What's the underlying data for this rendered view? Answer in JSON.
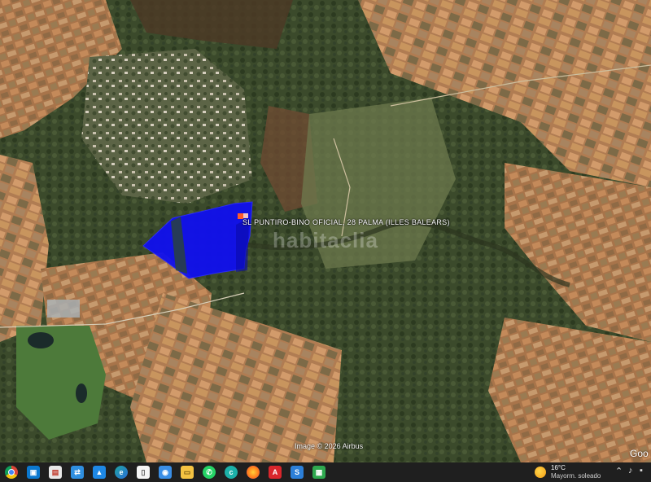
{
  "map": {
    "parcel_label": "SL PUNTIRO-BINO OFICIAL, 28 PALMA (ILLES BALEARS)",
    "watermark": "habitaclia",
    "attribution": "Image © 2026 Airbus",
    "logo": "Goo",
    "parcel_fill_color": "#1010ee",
    "marker_color": "#ff5a2a"
  },
  "taskbar": {
    "apps": [
      {
        "name": "chrome-icon",
        "color": "#db4437"
      },
      {
        "name": "remote-desktop-icon",
        "color": "#0b78d0"
      },
      {
        "name": "presentation-icon",
        "color": "#e8e8e8"
      },
      {
        "name": "network-icon",
        "color": "#2f8fe0"
      },
      {
        "name": "photos-icon",
        "color": "#1e88e5"
      },
      {
        "name": "edge-icon",
        "color": "#1ea3a3"
      },
      {
        "name": "document-icon",
        "color": "#f5f5f5"
      },
      {
        "name": "camera-icon",
        "color": "#3a8ee6"
      },
      {
        "name": "file-explorer-icon",
        "color": "#f5c342"
      },
      {
        "name": "whatsapp-icon",
        "color": "#25d366"
      },
      {
        "name": "teams-icon",
        "color": "#1cb0a8"
      },
      {
        "name": "firefox-icon",
        "color": "#ff7a1a"
      },
      {
        "name": "acrobat-icon",
        "color": "#d9262c"
      },
      {
        "name": "sourcetree-icon",
        "color": "#2c7fd8"
      },
      {
        "name": "sheets-icon",
        "color": "#2fa84f"
      }
    ],
    "weather": {
      "temperature": "16°C",
      "description": "Mayorm. soleado"
    }
  }
}
